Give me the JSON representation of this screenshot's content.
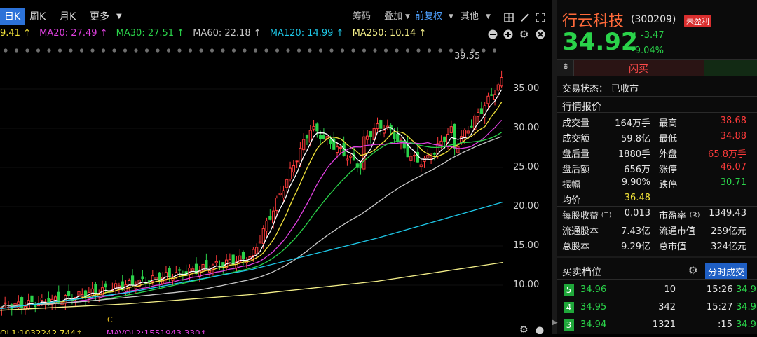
{
  "chart": {
    "periods": [
      {
        "label": "日K",
        "active": true
      },
      {
        "label": "周K",
        "active": false
      },
      {
        "label": "月K",
        "active": false
      },
      {
        "label": "更多",
        "active": false
      }
    ],
    "tools": {
      "chip": "筹码",
      "overlay": "叠加",
      "adjust": "前复权",
      "other": "其他"
    },
    "ma": [
      {
        "text": "9.41 ↑",
        "color": "#f3e33a"
      },
      {
        "text": "MA20: 27.49 ↑",
        "color": "#e040e0"
      },
      {
        "text": "MA30: 27.51 ↑",
        "color": "#2ad34a"
      },
      {
        "text": "MA60: 22.18 ↑",
        "color": "#c8c8c8"
      },
      {
        "text": "MA120: 14.99 ↑",
        "color": "#1ec8e8"
      },
      {
        "text": "MA250: 10.14 ↑",
        "color": "#f5f08a"
      }
    ],
    "price_ticks": [
      "35.00",
      "30.00",
      "25.00",
      "20.00",
      "15.00",
      "10.00"
    ],
    "high_marker": "39.55",
    "marker_c": "C",
    "vol_line": "OL1:1032242.744↑",
    "mavol_line": "MAVOL2:1551943.330↑"
  },
  "chart_data": {
    "type": "candlestick",
    "ylim": [
      6.5,
      40
    ],
    "price_ticks": [
      35,
      30,
      25,
      20,
      15,
      10
    ],
    "ma_colors": {
      "ma5": "#ffffff",
      "ma10": "#f3e33a",
      "ma20": "#e040e0",
      "ma30": "#2ad34a",
      "ma60": "#c8c8c8",
      "ma120": "#1ec8e8",
      "ma250": "#f5f08a"
    }
  },
  "quote": {
    "name": "行云科技",
    "code": "(300209)",
    "badge": "未盈利",
    "price": "34.92",
    "change": "-3.47",
    "change_pct": "-9.04%",
    "flash_buy": "闪买",
    "status_label": "交易状态：",
    "status_value": "已收市",
    "section_title": "行情报价",
    "rows": [
      {
        "l1": "成交量",
        "v1": "164万手",
        "c1": "white",
        "l2": "最高",
        "v2": "38.68",
        "c2": "red"
      },
      {
        "l1": "成交额",
        "v1": "59.8亿",
        "c1": "white",
        "l2": "最低",
        "v2": "34.88",
        "c2": "red"
      },
      {
        "l1": "盘后量",
        "v1": "1880手",
        "c1": "white",
        "l2": "外盘",
        "v2": "65.8万手",
        "c2": "red"
      },
      {
        "l1": "盘后额",
        "v1": "656万",
        "c1": "white",
        "l2": "涨停",
        "v2": "46.07",
        "c2": "red"
      },
      {
        "l1": "振幅",
        "v1": "9.90%",
        "c1": "white",
        "l2": "跌停",
        "v2": "30.71",
        "c2": "green"
      },
      {
        "l1": "均价",
        "v1": "36.48",
        "c1": "yellow",
        "l2": "",
        "v2": "",
        "c2": "white"
      }
    ],
    "rows2": [
      {
        "l1": "每股收益",
        "sub1": "(二)",
        "v1": "0.013",
        "l2": "市盈率",
        "sub2": "(动)",
        "v2": "1349.43"
      },
      {
        "l1": "流通股本",
        "sub1": "",
        "v1": "7.43亿",
        "l2": "流通市值",
        "sub2": "",
        "v2": "259亿元"
      },
      {
        "l1": "总股本",
        "sub1": "",
        "v1": "9.29亿",
        "l2": "总市值",
        "sub2": "",
        "v2": "324亿元"
      }
    ],
    "orderbook_title": "买卖档位",
    "trades_tab": "分时成交",
    "bids": [
      {
        "level": "5",
        "price": "34.96",
        "qty": "10"
      },
      {
        "level": "4",
        "price": "34.95",
        "qty": "342"
      },
      {
        "level": "3",
        "price": "34.94",
        "qty": "1321"
      }
    ],
    "trades": [
      {
        "time": "15:26",
        "price": "34.9"
      },
      {
        "time": "15:27",
        "price": "34.9"
      },
      {
        "time": ":15",
        "price": "34.9"
      }
    ]
  }
}
